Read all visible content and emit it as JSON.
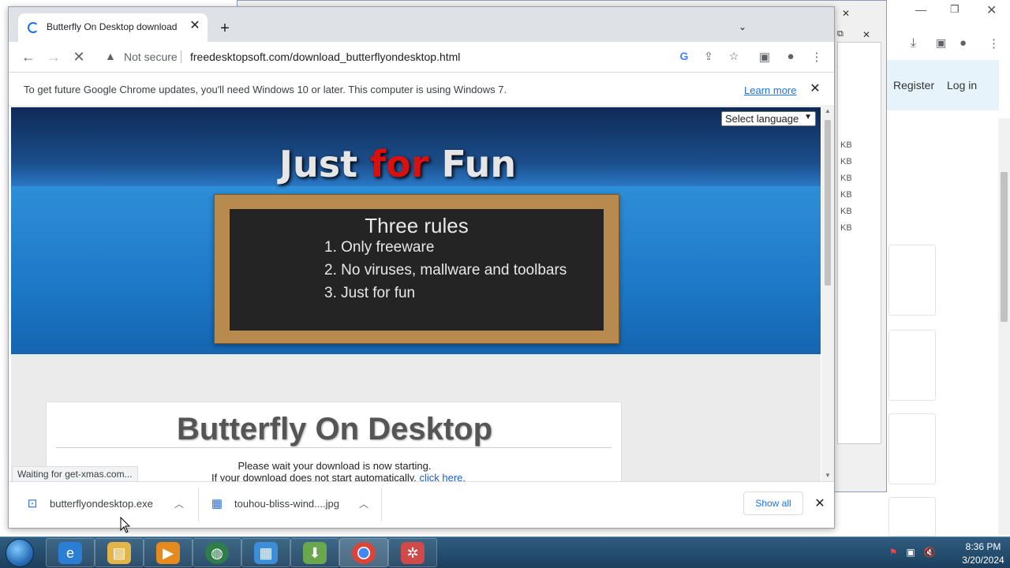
{
  "chrome": {
    "tab_title": "Butterfly On Desktop download",
    "tab_close": "✕",
    "new_tab": "+",
    "tab_list": "⌄",
    "url_security": "Not secure",
    "url": "freedesktopsoft.com/download_butterflyondesktop.html",
    "back": "←",
    "forward": "→",
    "reload": "✕"
  },
  "infobar": {
    "message": "To get future Google Chrome updates, you'll need Windows 10 or later. This computer is using Windows 7.",
    "learn_more": "Learn more",
    "close": "✕"
  },
  "page": {
    "language_select": "Select language",
    "banner_title_part1": "Just ",
    "banner_title_red": "for",
    "banner_title_part2": " Fun",
    "rules_title": "Three rules",
    "rules": [
      "1. Only freeware",
      "2. No viruses, mallware and toolbars",
      "3. Just for fun"
    ],
    "product_title": "Butterfly On Desktop",
    "wait_text": "Please wait your download is now starting.",
    "wait_text2_prefix": "If your download does not start automatically, ",
    "click_here": "click here."
  },
  "status": "Waiting for get-xmas.com...",
  "downloads": {
    "items": [
      {
        "name": "butterflyondesktop.exe",
        "icon": "exe-file-icon"
      },
      {
        "name": "touhou-bliss-wind....jpg",
        "icon": "image-file-icon"
      }
    ],
    "show_all": "Show all",
    "close": "✕"
  },
  "background_window": {
    "register": "Register",
    "login": "Log in",
    "kb_labels": [
      "KB",
      "KB",
      "KB",
      "KB",
      "KB",
      "KB"
    ]
  },
  "taskbar": {
    "time": "8:36 PM",
    "date": "3/20/2024"
  }
}
